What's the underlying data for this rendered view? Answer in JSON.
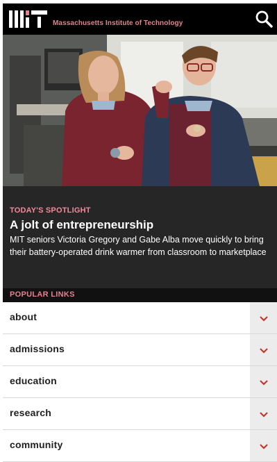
{
  "header": {
    "site_title": "Massachusetts Institute of Technology",
    "logo_icon": "mit-logo-icon",
    "search_icon": "search-icon"
  },
  "spotlight": {
    "kicker": "TODAY'S SPOTLIGHT",
    "title": "A jolt of entrepreneurship",
    "text": "MIT seniors Victoria Gregory and Gabe Alba move quickly to bring their battery-operated drink warmer from classroom to marketplace"
  },
  "popular_links": {
    "heading": "POPULAR LINKS",
    "items": [
      {
        "label": "about"
      },
      {
        "label": "admissions"
      },
      {
        "label": "education"
      },
      {
        "label": "research"
      },
      {
        "label": "community"
      }
    ],
    "expand_icon": "chevron-down-icon"
  },
  "colors": {
    "accent": "#e7818e",
    "header_bg": "#000000",
    "spotlight_bg": "#262626",
    "chevron": "#c0392b"
  }
}
